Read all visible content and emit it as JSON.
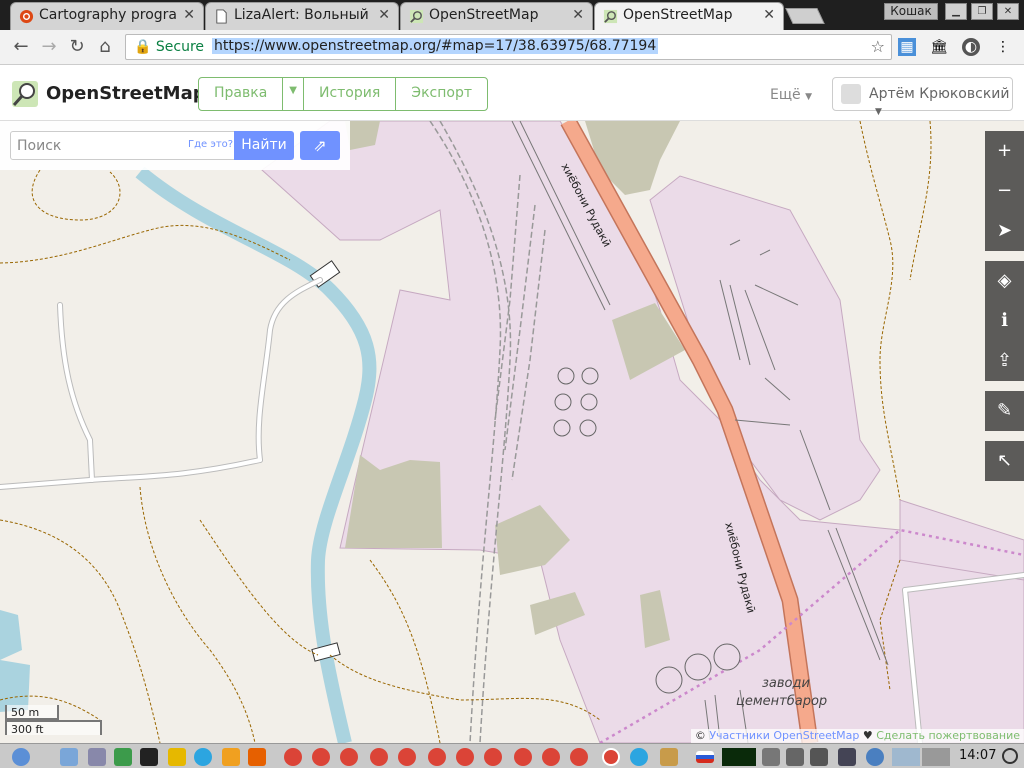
{
  "browser": {
    "tabs": [
      {
        "title": "Cartography progra",
        "icon": "ubuntu-icon",
        "active": false
      },
      {
        "title": "LizaAlert: Вольный",
        "icon": "document-icon",
        "active": false
      },
      {
        "title": "OpenStreetMap",
        "icon": "osm-icon",
        "active": false
      },
      {
        "title": "OpenStreetMap",
        "icon": "osm-icon",
        "active": true
      }
    ],
    "profile_name": "Кошак",
    "secure_label": "Secure",
    "url": "https://www.openstreetmap.org/#map=17/38.63975/68.77194"
  },
  "osm": {
    "brand": "OpenStreetMap",
    "nav": {
      "edit": "Правка",
      "history": "История",
      "export": "Экспорт"
    },
    "more": "Ещё",
    "user": "Артём Крюковский",
    "search": {
      "placeholder": "Поиск",
      "whats_this": "Где это?",
      "go": "Найти"
    }
  },
  "map": {
    "road_label_1": "хиёбони Рудакӣ",
    "road_label_2": "хиёбони Рудакӣ",
    "area_label_1": "заводи",
    "area_label_2": "цементбарор",
    "scale_metric": "50 m",
    "scale_imperial": "300 ft",
    "attribution_prefix": "© ",
    "attribution_contributors": "Участники OpenStreetMap",
    "attribution_heart": " ♥ ",
    "attribution_donate": "Сделать пожертвование",
    "colors": {
      "landuse_industrial": "#ebdbe8",
      "landuse_industrial_border": "#c6a9c1",
      "road_primary": "#f5a98c",
      "road_primary_casing": "#c4755b",
      "river": "#aad3df",
      "scrub": "#c8c7b2",
      "track": "#996600",
      "boundary": "#cc88cc"
    }
  },
  "taskbar": {
    "clock": "14:07"
  }
}
